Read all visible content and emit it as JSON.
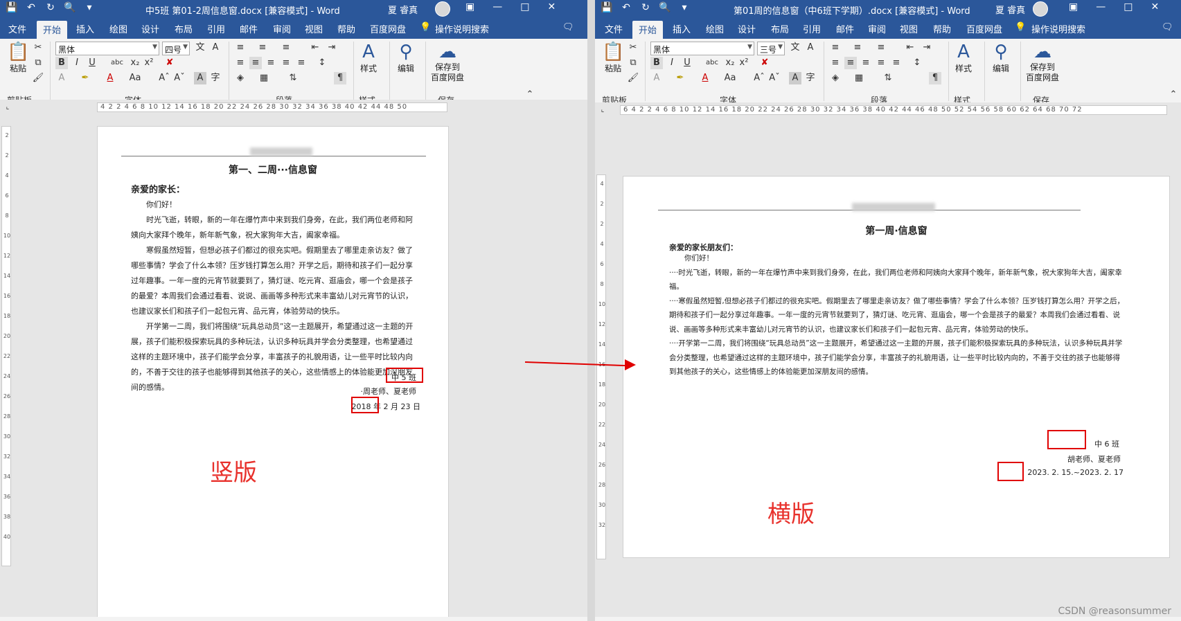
{
  "left": {
    "title": "中5班 第01-2周信息窗.docx [兼容模式] - Word",
    "user": "夏 睿真",
    "tabs": [
      "文件",
      "开始",
      "插入",
      "绘图",
      "设计",
      "布局",
      "引用",
      "邮件",
      "审阅",
      "视图",
      "帮助",
      "百度网盘"
    ],
    "search": "操作说明搜索",
    "font_name": "黑体",
    "font_size": "四号",
    "ruler": "4 2 2 4 6 8 10 12 14 16 18 20 22 24 26 28 30 32 34 36 38 40 42 44 48 50",
    "vruler": [
      "2",
      "2",
      "4",
      "6",
      "8",
      "10",
      "12",
      "14",
      "16",
      "18",
      "20",
      "22",
      "24",
      "26",
      "28",
      "30",
      "32",
      "34",
      "36",
      "38",
      "40"
    ],
    "doc": {
      "heading": "第一、二周···信息窗",
      "greeting": "亲爱的家长：",
      "hello": "你们好！",
      "paragraphs": [
        "时光飞逝，转眼，新的一年在爆竹声中来到我们身旁，在此，我们两位老师和阿姨向大家拜个晚年，新年新气象，祝大家狗年大吉，阖家幸福。",
        "寒假虽然短暂，但想必孩子们都过的很充实吧。假期里去了哪里走亲访友？做了哪些事情？学会了什么本领？压岁钱打算怎么用？开学之后，期待和孩子们一起分享过年趣事。一年一度的元宵节就要到了，猜灯谜、吃元宵、逛庙会，哪一个会是孩子的最爱？本周我们会通过看看、说说、画画等多种形式来丰富幼儿对元宵节的认识，也建议家长们和孩子们一起包元宵、品元宵，体验劳动的快乐。",
        "开学第一二周，我们将围绕“玩具总动员”这一主题展开，希望通过这一主题的开展，孩子们能积极探索玩具的多种玩法，认识多种玩具并学会分类整理，也希望通过这样的主题环境中，孩子们能学会分享，丰富孩子的礼貌用语，让一些平时比较内向的，不善于交往的孩子也能够得到其他孩子的关心，这些情感上的体验能更加深朋友间的感情。"
      ],
      "class": "中 5 班",
      "teachers": "·周老师、夏老师",
      "year": "2018",
      "date_rest": " 年 2 月 23 日"
    },
    "label": "竖版"
  },
  "right": {
    "title": "第01周的信息窗（中6班下学期）.docx [兼容模式] - Word",
    "user": "夏 睿真",
    "tabs": [
      "文件",
      "开始",
      "插入",
      "绘图",
      "设计",
      "布局",
      "引用",
      "邮件",
      "审阅",
      "视图",
      "帮助",
      "百度网盘"
    ],
    "search": "操作说明搜索",
    "font_name": "黑体",
    "font_size": "三号",
    "ruler": "6 4 2 2 4 6 8 10 12 14 16 18 20 22 24 26 28 30 32 34 36 38 40 42 44 46 48 50 52 54 56 58 60 62 64 68 70 72",
    "vruler": [
      "4",
      "2",
      "2",
      "4",
      "6",
      "8",
      "10",
      "12",
      "14",
      "16",
      "18",
      "20",
      "22",
      "24",
      "26",
      "28",
      "30",
      "32"
    ],
    "doc": {
      "heading": "第一周·信息窗",
      "greeting": "亲爱的家长朋友们：",
      "hello": "你们好！",
      "paragraphs": [
        "····时光飞逝，转眼，新的一年在爆竹声中来到我们身旁，在此，我们两位老师和阿姨向大家拜个晚年，新年新气象，祝大家狗年大吉，阖家幸福。",
        "····寒假虽然短暂,但想必孩子们都过的很充实吧。假期里去了哪里走亲访友？做了哪些事情？学会了什么本领？压岁钱打算怎么用？开学之后，期待和孩子们一起分享过年趣事。一年一度的元宵节就要到了，猜灯谜、吃元宵、逛庙会，哪一个会是孩子的最爱？本周我们会通过看看、说说、画画等多种形式来丰富幼儿对元宵节的认识，也建议家长们和孩子们一起包元宵、品元宵，体验劳动的快乐。",
        "····开学第一二周，我们将围绕“玩具总动员”这一主题展开，希望通过这一主题的开展，孩子们能积极探索玩具的多种玩法，认识多种玩具并学会分类整理，也希望通过这样的主题环境中，孩子们能学会分享，丰富孩子的礼貌用语，让一些平时比较内向的，不善于交往的孩子也能够得到其他孩子的关心，这些情感上的体验能更加深朋友间的感情。"
      ],
      "class": "中 6 班",
      "teachers": "胡老师、夏老师",
      "year": "2023",
      "date_rest": ". 2. 15.~2023. 2. 17"
    },
    "label": "横版"
  },
  "ribbon": {
    "paste": "粘贴",
    "styles": "样式",
    "edit": "编辑",
    "save_baidu_1": "保存到",
    "save_baidu_2": "百度网盘",
    "groups": [
      "剪贴板",
      "字体",
      "段落",
      "样式",
      "保存"
    ]
  },
  "watermark": "CSDN @reasonsummer"
}
